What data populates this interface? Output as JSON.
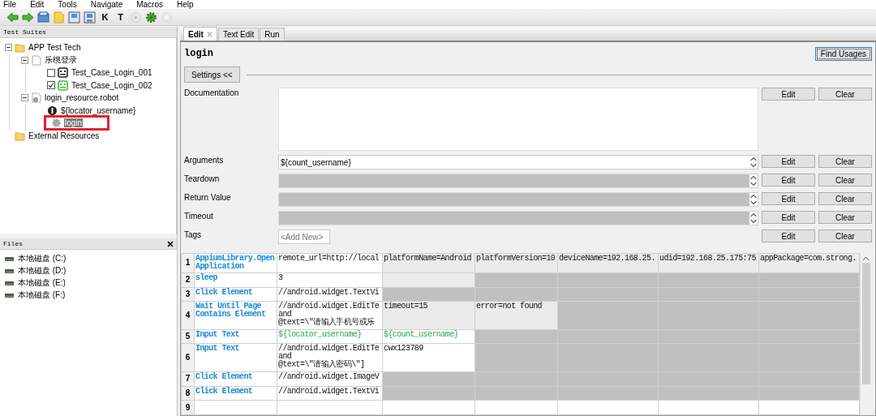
{
  "menu": [
    "File",
    "Edit",
    "Tools",
    "Navigate",
    "Macros",
    "Help"
  ],
  "toolbar": [
    {
      "kind": "back"
    },
    {
      "kind": "forward"
    },
    {
      "kind": "open"
    },
    {
      "kind": "folder"
    },
    {
      "kind": "save"
    },
    {
      "kind": "saveall"
    },
    {
      "kind": "keyword-search",
      "label": "K"
    },
    {
      "kind": "test-search",
      "label": "T"
    },
    {
      "kind": "run",
      "disabled": true
    },
    {
      "kind": "gear"
    },
    {
      "kind": "stop",
      "disabled": true
    }
  ],
  "test_suites": {
    "title": "Test Suites",
    "items": [
      {
        "label": "APP Test Tech",
        "kind": "folder",
        "expanded": true,
        "children": [
          {
            "label": "乐桃登录",
            "kind": "suite",
            "expanded": true,
            "children": [
              {
                "label": "Test_Case_Login_001",
                "kind": "testcase",
                "checked": false,
                "color": "#222222"
              },
              {
                "label": "Test_Case_Login_002",
                "kind": "testcase",
                "checked": true,
                "color": "#3cc03c"
              }
            ]
          },
          {
            "label": "login_resource.robot",
            "kind": "resource",
            "expanded": true,
            "children": [
              {
                "label": "${locator_username}",
                "kind": "variable"
              },
              {
                "label": "login",
                "kind": "keyword",
                "selected": true,
                "highlighted": true
              }
            ]
          }
        ]
      },
      {
        "label": "External Resources",
        "kind": "folder"
      }
    ]
  },
  "files": {
    "title": "Files",
    "items": [
      "本地磁盘 (C:)",
      "本地磁盘 (D:)",
      "本地磁盘 (E:)",
      "本地磁盘 (F:)"
    ]
  },
  "tabs": [
    {
      "label": "Edit",
      "selected": true,
      "closable": true
    },
    {
      "label": "Text Edit",
      "selected": false
    },
    {
      "label": "Run",
      "selected": false
    }
  ],
  "editor": {
    "title": "login",
    "find_button": "Find Usages",
    "settings_button": "Settings <<",
    "settings": [
      {
        "label": "Documentation",
        "kind": "textarea",
        "edit_button": "Edit",
        "clear_button": "Clear"
      },
      {
        "label": "Arguments",
        "kind": "field",
        "value": "${count_username}",
        "disabled": false,
        "edit_button": "Edit",
        "clear_button": "Clear"
      },
      {
        "label": "Teardown",
        "kind": "field",
        "disabled": true,
        "edit_button": "Edit",
        "clear_button": "Clear"
      },
      {
        "label": "Return Value",
        "kind": "field",
        "disabled": true,
        "edit_button": "Edit",
        "clear_button": "Clear"
      },
      {
        "label": "Timeout",
        "kind": "field",
        "disabled": true,
        "edit_button": "Edit",
        "clear_button": "Clear"
      },
      {
        "label": "Tags",
        "kind": "tags",
        "placeholder": "<Add New>",
        "edit_button": "Edit",
        "clear_button": "Clear"
      }
    ]
  },
  "grid": {
    "rows": [
      {
        "number": "1",
        "cells": [
          {
            "text": "AppiumLibrary.Open Application",
            "kind": "keyword",
            "optional": false,
            "unused": false
          },
          {
            "text": "remote_url=http://local",
            "kind": "text",
            "optional": false,
            "unused": false
          },
          {
            "text": "platformName=Android",
            "kind": "text",
            "optional": true,
            "unused": false
          },
          {
            "text": "platformVersion=10",
            "kind": "text",
            "optional": true,
            "unused": false
          },
          {
            "text": "deviceName=192.168.25.",
            "kind": "text",
            "optional": true,
            "unused": false
          },
          {
            "text": "udid=192.168.25.175:75",
            "kind": "text",
            "optional": true,
            "unused": false
          },
          {
            "text": "appPackage=com.strong.",
            "kind": "text",
            "optional": true,
            "unused": false
          }
        ]
      },
      {
        "number": "2",
        "cells": [
          {
            "text": "sleep",
            "kind": "keyword",
            "optional": false,
            "unused": false
          },
          {
            "text": "3",
            "kind": "text",
            "optional": false,
            "unused": false
          },
          {
            "optional": true,
            "unused": false
          },
          {
            "optional": false,
            "unused": true
          },
          {
            "optional": false,
            "unused": true
          },
          {
            "optional": false,
            "unused": true
          },
          {
            "optional": false,
            "unused": true
          }
        ]
      },
      {
        "number": "3",
        "cells": [
          {
            "text": "Click Element",
            "kind": "keyword",
            "optional": false,
            "unused": false
          },
          {
            "text": "//android.widget.TextVi",
            "kind": "text",
            "optional": false,
            "unused": false
          },
          {
            "optional": false,
            "unused": true
          },
          {
            "optional": false,
            "unused": true
          },
          {
            "optional": false,
            "unused": true
          },
          {
            "optional": false,
            "unused": true
          },
          {
            "optional": false,
            "unused": true
          }
        ]
      },
      {
        "number": "4",
        "cells": [
          {
            "text": "Wait Until Page Contains Element",
            "kind": "keyword",
            "optional": false,
            "unused": false
          },
          {
            "text": "//android.widget.EditTe\nand\n@text=\\\"请输入手机号或乐",
            "kind": "text",
            "optional": false,
            "unused": false
          },
          {
            "text": "timeout=15",
            "kind": "text",
            "optional": true,
            "unused": false
          },
          {
            "text": "error=not found",
            "kind": "text",
            "optional": true,
            "unused": false
          },
          {
            "optional": false,
            "unused": true
          },
          {
            "optional": false,
            "unused": true
          },
          {
            "optional": false,
            "unused": true
          }
        ]
      },
      {
        "number": "5",
        "cells": [
          {
            "text": "Input Text",
            "kind": "keyword",
            "optional": false,
            "unused": false
          },
          {
            "text": "${locator_username}",
            "kind": "variable",
            "optional": false,
            "unused": false
          },
          {
            "text": "${count_username}",
            "kind": "variable",
            "optional": false,
            "unused": false
          },
          {
            "optional": false,
            "unused": true
          },
          {
            "optional": false,
            "unused": true
          },
          {
            "optional": false,
            "unused": true
          },
          {
            "optional": false,
            "unused": true
          }
        ]
      },
      {
        "number": "6",
        "cells": [
          {
            "text": "Input Text",
            "kind": "keyword",
            "optional": false,
            "unused": false
          },
          {
            "text": "//android.widget.EditTe\nand\n@text=\\\"请输入密码\\\"]",
            "kind": "text",
            "optional": false,
            "unused": false
          },
          {
            "text": "cwx123789",
            "kind": "text",
            "optional": false,
            "unused": false
          },
          {
            "optional": false,
            "unused": true
          },
          {
            "optional": false,
            "unused": true
          },
          {
            "optional": false,
            "unused": true
          },
          {
            "optional": false,
            "unused": true
          }
        ]
      },
      {
        "number": "7",
        "cells": [
          {
            "text": "Click Element",
            "kind": "keyword",
            "optional": false,
            "unused": false
          },
          {
            "text": "//android.widget.ImageV",
            "kind": "text",
            "optional": false,
            "unused": false
          },
          {
            "optional": false,
            "unused": true
          },
          {
            "optional": false,
            "unused": true
          },
          {
            "optional": false,
            "unused": true
          },
          {
            "optional": false,
            "unused": true
          },
          {
            "optional": false,
            "unused": true
          }
        ]
      },
      {
        "number": "8",
        "cells": [
          {
            "text": "Click Element",
            "kind": "keyword",
            "optional": false,
            "unused": false
          },
          {
            "text": "//android.widget.TextVi",
            "kind": "text",
            "optional": false,
            "unused": false
          },
          {
            "optional": false,
            "unused": true
          },
          {
            "optional": false,
            "unused": true
          },
          {
            "optional": false,
            "unused": true
          },
          {
            "optional": false,
            "unused": true
          },
          {
            "optional": false,
            "unused": true
          }
        ]
      },
      {
        "number": "9",
        "cells": [
          {
            "optional": false,
            "unused": false
          },
          {
            "optional": false,
            "unused": false
          },
          {
            "optional": false,
            "unused": false
          },
          {
            "optional": false,
            "unused": false
          },
          {
            "optional": false,
            "unused": false
          },
          {
            "optional": false,
            "unused": false
          },
          {
            "optional": false,
            "unused": false
          }
        ]
      }
    ]
  }
}
